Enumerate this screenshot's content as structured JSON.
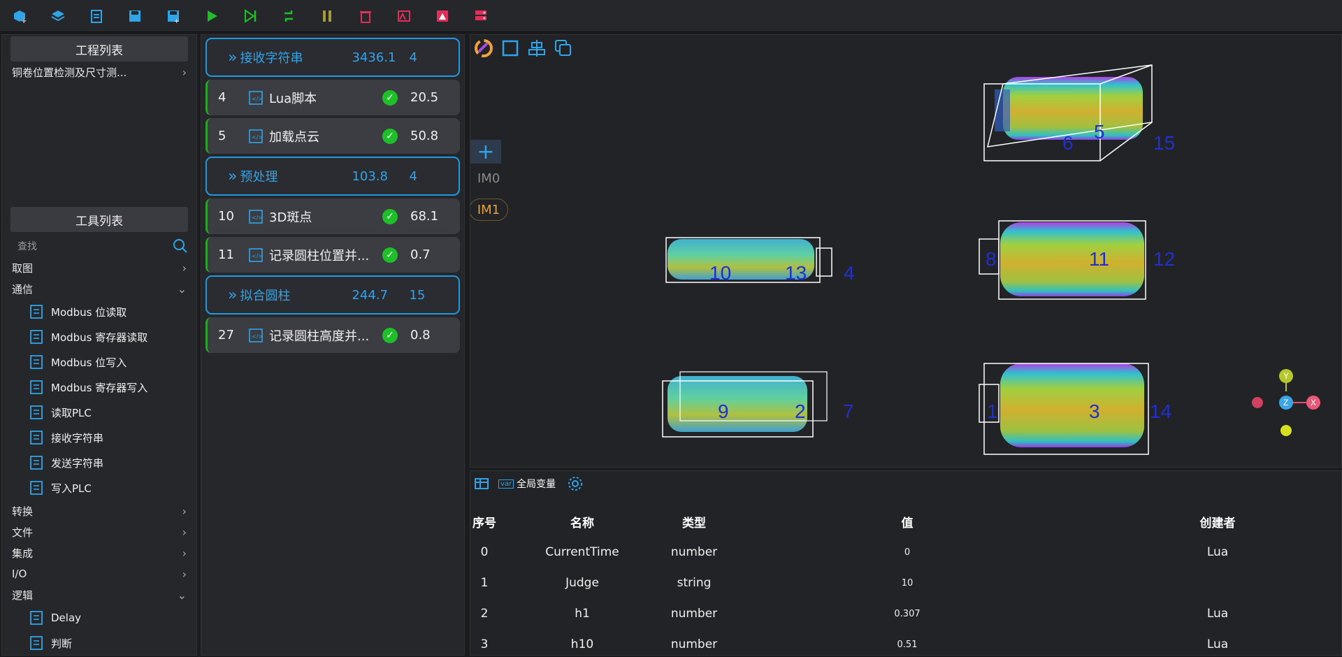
{
  "toolbar": {
    "buttons": [
      {
        "icon": "new-project-icon",
        "color": "#2fa4e9"
      },
      {
        "icon": "open-project-icon",
        "color": "#2fa4e9"
      },
      {
        "icon": "import-icon",
        "color": "#2fa4e9"
      },
      {
        "icon": "save-icon",
        "color": "#2fa4e9"
      },
      {
        "icon": "save-as-icon",
        "color": "#2fa4e9"
      },
      {
        "icon": "run-icon",
        "color": "#1fbf2a"
      },
      {
        "icon": "step-run-icon",
        "color": "#1fbf2a"
      },
      {
        "icon": "loop-run-icon",
        "color": "#1fbf2a"
      },
      {
        "icon": "pause-icon",
        "color": "#a89a3a"
      },
      {
        "icon": "delete-icon",
        "color": "#e02f5a"
      },
      {
        "icon": "text-image-icon",
        "color": "#e02f5a"
      },
      {
        "icon": "image-icon",
        "color": "#e02f5a"
      },
      {
        "icon": "server-icon",
        "color": "#e02f5a"
      }
    ]
  },
  "project_list": {
    "title": "工程列表",
    "items": [
      {
        "label": "铜卷位置检测及尺寸测..."
      }
    ]
  },
  "tool_list": {
    "title": "工具列表",
    "search_placeholder": "查找",
    "categories": [
      {
        "label": "取图",
        "expanded": false
      },
      {
        "label": "通信",
        "expanded": true,
        "tools": [
          {
            "label": "Modbus 位读取",
            "icon": "download-icon"
          },
          {
            "label": "Modbus 寄存器读取",
            "icon": "file-search-icon"
          },
          {
            "label": "Modbus 位写入",
            "icon": "upload-icon"
          },
          {
            "label": "Modbus 寄存器写入",
            "icon": "file-edit-icon"
          },
          {
            "label": "读取PLC",
            "icon": "plc-icon"
          },
          {
            "label": "接收字符串",
            "icon": "receive-string-icon"
          },
          {
            "label": "发送字符串",
            "icon": "send-string-icon"
          },
          {
            "label": "写入PLC",
            "icon": "write-plc-icon"
          }
        ]
      },
      {
        "label": "转换",
        "expanded": false
      },
      {
        "label": "文件",
        "expanded": false
      },
      {
        "label": "集成",
        "expanded": false
      },
      {
        "label": "I/O",
        "expanded": false
      },
      {
        "label": "逻辑",
        "expanded": true,
        "tools": [
          {
            "label": "Delay",
            "icon": "hourglass-icon"
          },
          {
            "label": "判断",
            "icon": "check-box-icon"
          }
        ]
      }
    ]
  },
  "flow": [
    {
      "kind": "group",
      "name": "接收字符串",
      "time": "3436.1",
      "count": "4"
    },
    {
      "kind": "node",
      "id": "4",
      "name": "Lua脚本",
      "time": "20.5",
      "icon": "script-icon"
    },
    {
      "kind": "node",
      "id": "5",
      "name": "加载点云",
      "time": "50.8",
      "icon": "point-cloud-icon"
    },
    {
      "kind": "group",
      "name": "预处理",
      "time": "103.8",
      "count": "4"
    },
    {
      "kind": "node",
      "id": "10",
      "name": "3D斑点",
      "time": "68.1",
      "icon": "blob-icon"
    },
    {
      "kind": "node",
      "id": "11",
      "name": "记录圆柱位置并...",
      "time": "0.7",
      "icon": "script-icon"
    },
    {
      "kind": "group",
      "name": "拟合圆柱",
      "time": "244.7",
      "count": "15"
    },
    {
      "kind": "node",
      "id": "27",
      "name": "记录圆柱高度并...",
      "time": "0.8",
      "icon": "script-icon"
    }
  ],
  "viewer": {
    "add_label": "+",
    "image_tags": [
      "IM0",
      "IM1"
    ],
    "box_labels": [
      "6",
      "5",
      "15",
      "10",
      "13",
      "4",
      "8",
      "11",
      "12",
      "9",
      "2",
      "7",
      "1",
      "3",
      "14"
    ],
    "axis_labels": {
      "y": "Y",
      "z": "Z",
      "x": "X"
    }
  },
  "variables": {
    "tab_label": "全局变量",
    "var_icon_text": "var",
    "columns": [
      "序号",
      "名称",
      "类型",
      "值",
      "创建者"
    ],
    "rows": [
      [
        "0",
        "CurrentTime",
        "number",
        "0",
        "Lua"
      ],
      [
        "1",
        "Judge",
        "string",
        "10",
        ""
      ],
      [
        "2",
        "h1",
        "number",
        "0.307",
        "Lua"
      ],
      [
        "3",
        "h10",
        "number",
        "0.51",
        "Lua"
      ]
    ]
  }
}
